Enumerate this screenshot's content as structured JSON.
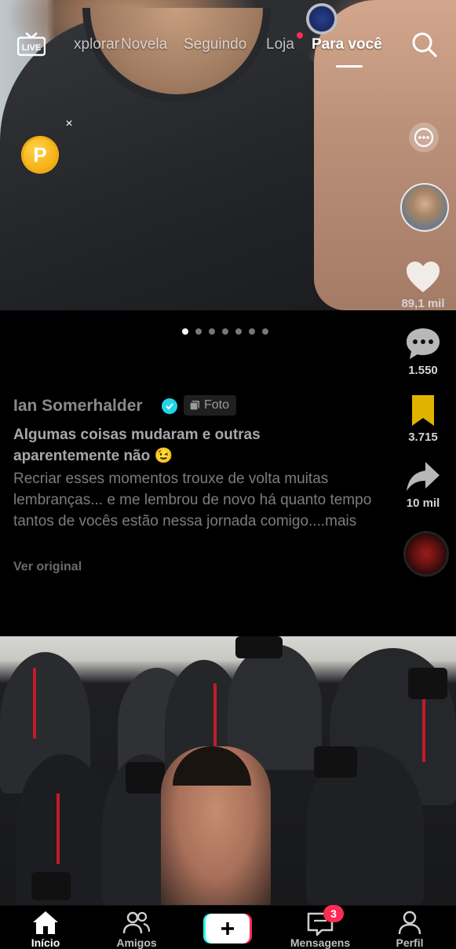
{
  "top_nav": {
    "live_label": "LIVE",
    "tabs": [
      {
        "label": "Explorar"
      },
      {
        "label": "Novela"
      },
      {
        "label": "Seguindo"
      },
      {
        "label": "Loja"
      },
      {
        "label": "Para você"
      }
    ],
    "active_tab": "Para você",
    "visible_first_tab": "xplorar"
  },
  "coin_widget": {
    "symbol": "P",
    "close_symbol": "×"
  },
  "post": {
    "like_count": "89,1 mil",
    "comment_count": "1.550",
    "save_count": "3.715",
    "share_count": "10 mil",
    "carousel": {
      "total": 7,
      "active_index": 0
    },
    "author": "Ian Somerhalder",
    "photo_badge": "Foto",
    "title": "Algumas coisas mudaram e outras aparentemente não 😉",
    "description": "Recriar esses momentos trouxe de volta muitas lembranças... e me lembrou de novo há quanto tempo tantos de vocês estão nessa jornada comigo....mais",
    "see_original": "Ver original"
  },
  "bottom_nav": {
    "items": [
      {
        "label": "Início"
      },
      {
        "label": "Amigos"
      },
      {
        "label": ""
      },
      {
        "label": "Mensagens"
      },
      {
        "label": "Perfil"
      }
    ],
    "messages_badge": "3"
  },
  "colors": {
    "accent_red": "#fe2c55",
    "accent_cyan": "#20d5ec",
    "bookmark_yellow": "#e0b300",
    "background": "#000000"
  }
}
